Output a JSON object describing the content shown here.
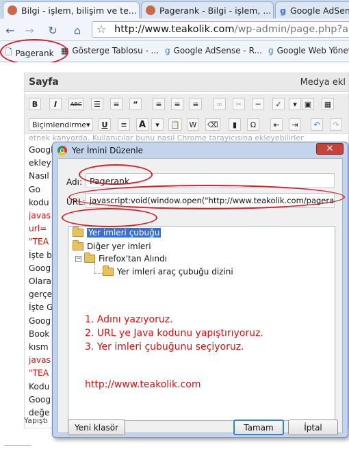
{
  "tabs": [
    {
      "label": "Bilgi - işlem, bilişim ve te...",
      "close": "×"
    },
    {
      "label": "Pagerank - Bilgi - işlem, ...",
      "close": "×"
    },
    {
      "label": "Google AdSense"
    }
  ],
  "address": {
    "domain": "http://www.teakolik.com",
    "path": "/wp-admin/page.php?actic"
  },
  "bookmarks": [
    {
      "label": "Pagerank"
    },
    {
      "label": "Gösterge Tablosu - ..."
    },
    {
      "label": "Google AdSense - R..."
    },
    {
      "label": "Google Web Yöneti"
    }
  ],
  "editor": {
    "title": "Sayfa",
    "media": "Medya ekl",
    "format_select": "Biçimlendirme",
    "status_path": "Yapıştı"
  },
  "body_lines": [
    {
      "text": "Google",
      "red": false
    },
    {
      "text": "ekley",
      "red": false
    },
    {
      "text": "Nasıl",
      "red": false
    },
    {
      "text": "    Go",
      "red": false
    },
    {
      "text": "kodu",
      "red": false
    },
    {
      "text": "javas",
      "red": true
    },
    {
      "text": "url=",
      "red": true
    },
    {
      "text": "\"TEA",
      "red": true
    },
    {
      "text": "İşte b",
      "red": false
    },
    {
      "text": "Goog",
      "red": false
    },
    {
      "text": "Olara",
      "red": false
    },
    {
      "text": "gerçe",
      "red": false
    },
    {
      "text": "İşte G",
      "red": false
    },
    {
      "text": "Goog",
      "red": false
    },
    {
      "text": "Book",
      "red": false
    },
    {
      "text": "kısm",
      "red": false
    },
    {
      "text": "javas",
      "red": true
    },
    {
      "text": "\"TEA",
      "red": true
    },
    {
      "text": "Kodu",
      "red": false
    },
    {
      "text": "Goog",
      "red": false
    },
    {
      "text": "değe",
      "red": false
    }
  ],
  "body_top_fragment": "etnek kanyorda. Kullanıcılar bunu nasıl Chrome tarayıcısına ekleyebilirler",
  "dialog": {
    "title": "Yer İmini Düzenle",
    "name_label": "Adı:",
    "name_value": "Pagerank",
    "url_label": "URL:",
    "url_value": "javascript:void(window.open(\"http://www.teakolik.com/pagerank/",
    "tree": {
      "selected": "Yer imleri çubuğu",
      "other": "Diğer yer imleri",
      "firefox": "Firefox'tan Alındı",
      "firefox_child": "Yer imleri araç çubuğu dizini"
    },
    "instructions": [
      "1. Adını yazıyoruz.",
      "2. URL ye Java kodunu yapıştırıyoruz.",
      "3. Yer imleri çubuğunu seçiyoruz."
    ],
    "site_link": "http://www.teakolik.com",
    "buttons": {
      "new_folder": "Yeni klasör",
      "ok": "Tamam",
      "cancel": "İptal"
    }
  },
  "colors": {
    "annotation": "#d0202a",
    "selection": "#3a6fcf",
    "dialog_frame": "#c4d4ea"
  }
}
